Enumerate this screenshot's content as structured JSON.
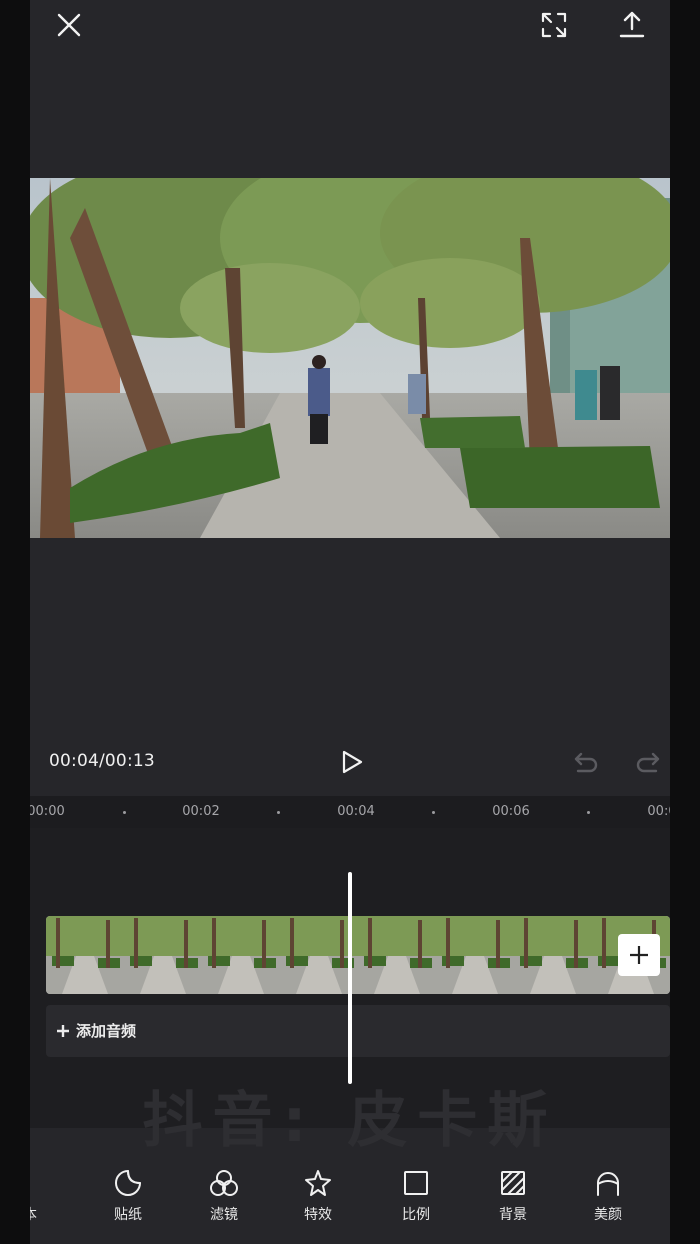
{
  "player": {
    "current_time": "00:04",
    "duration": "00:13",
    "time_display": "00:04/00:13"
  },
  "top_actions": {
    "close_icon": "close-icon",
    "fullscreen_icon": "fullscreen-icon",
    "export_icon": "export-icon"
  },
  "ruler": {
    "ticks": [
      "00:00",
      "00:02",
      "00:04",
      "00:06",
      "00:0"
    ]
  },
  "timeline": {
    "add_audio_label": "添加音频",
    "add_clip_icon": "plus-icon"
  },
  "watermark": "抖音: 皮卡斯",
  "toolbar": {
    "items": [
      {
        "label": "本",
        "icon": "text-icon"
      },
      {
        "label": "贴纸",
        "icon": "sticker-icon"
      },
      {
        "label": "滤镜",
        "icon": "filter-icon"
      },
      {
        "label": "特效",
        "icon": "effects-icon"
      },
      {
        "label": "比例",
        "icon": "ratio-icon"
      },
      {
        "label": "背景",
        "icon": "background-icon"
      },
      {
        "label": "美颜",
        "icon": "beauty-icon"
      }
    ]
  },
  "colors": {
    "editor_background": "#26262a",
    "timeline_background": "#1e1e21",
    "playhead": "#ffffff",
    "disabled_icon": "#5b5b60"
  }
}
